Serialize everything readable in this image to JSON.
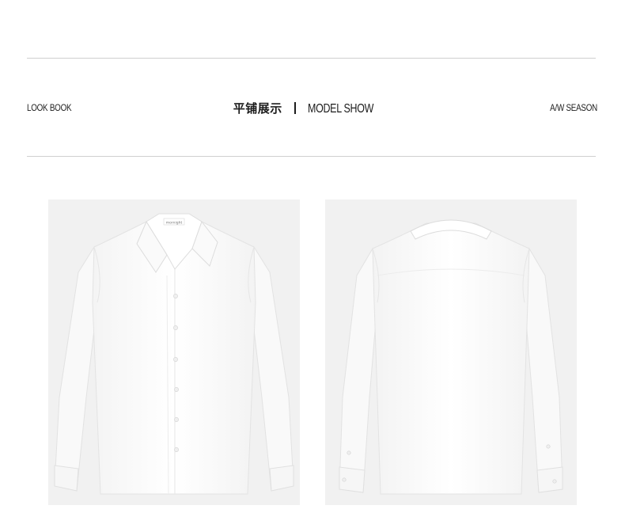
{
  "header": {
    "left_label": "LOOK BOOK",
    "title_cn": "平铺展示",
    "title_en": "MODEL SHOW",
    "right_label": "A/W SEASON"
  },
  "gallery": {
    "front_brand_tag": "mornight"
  },
  "colors": {
    "rule": "#cfcfcf",
    "photo_bg": "#f1f1f1",
    "shirt": "#fdfdfd",
    "text": "#1c1c1c"
  }
}
